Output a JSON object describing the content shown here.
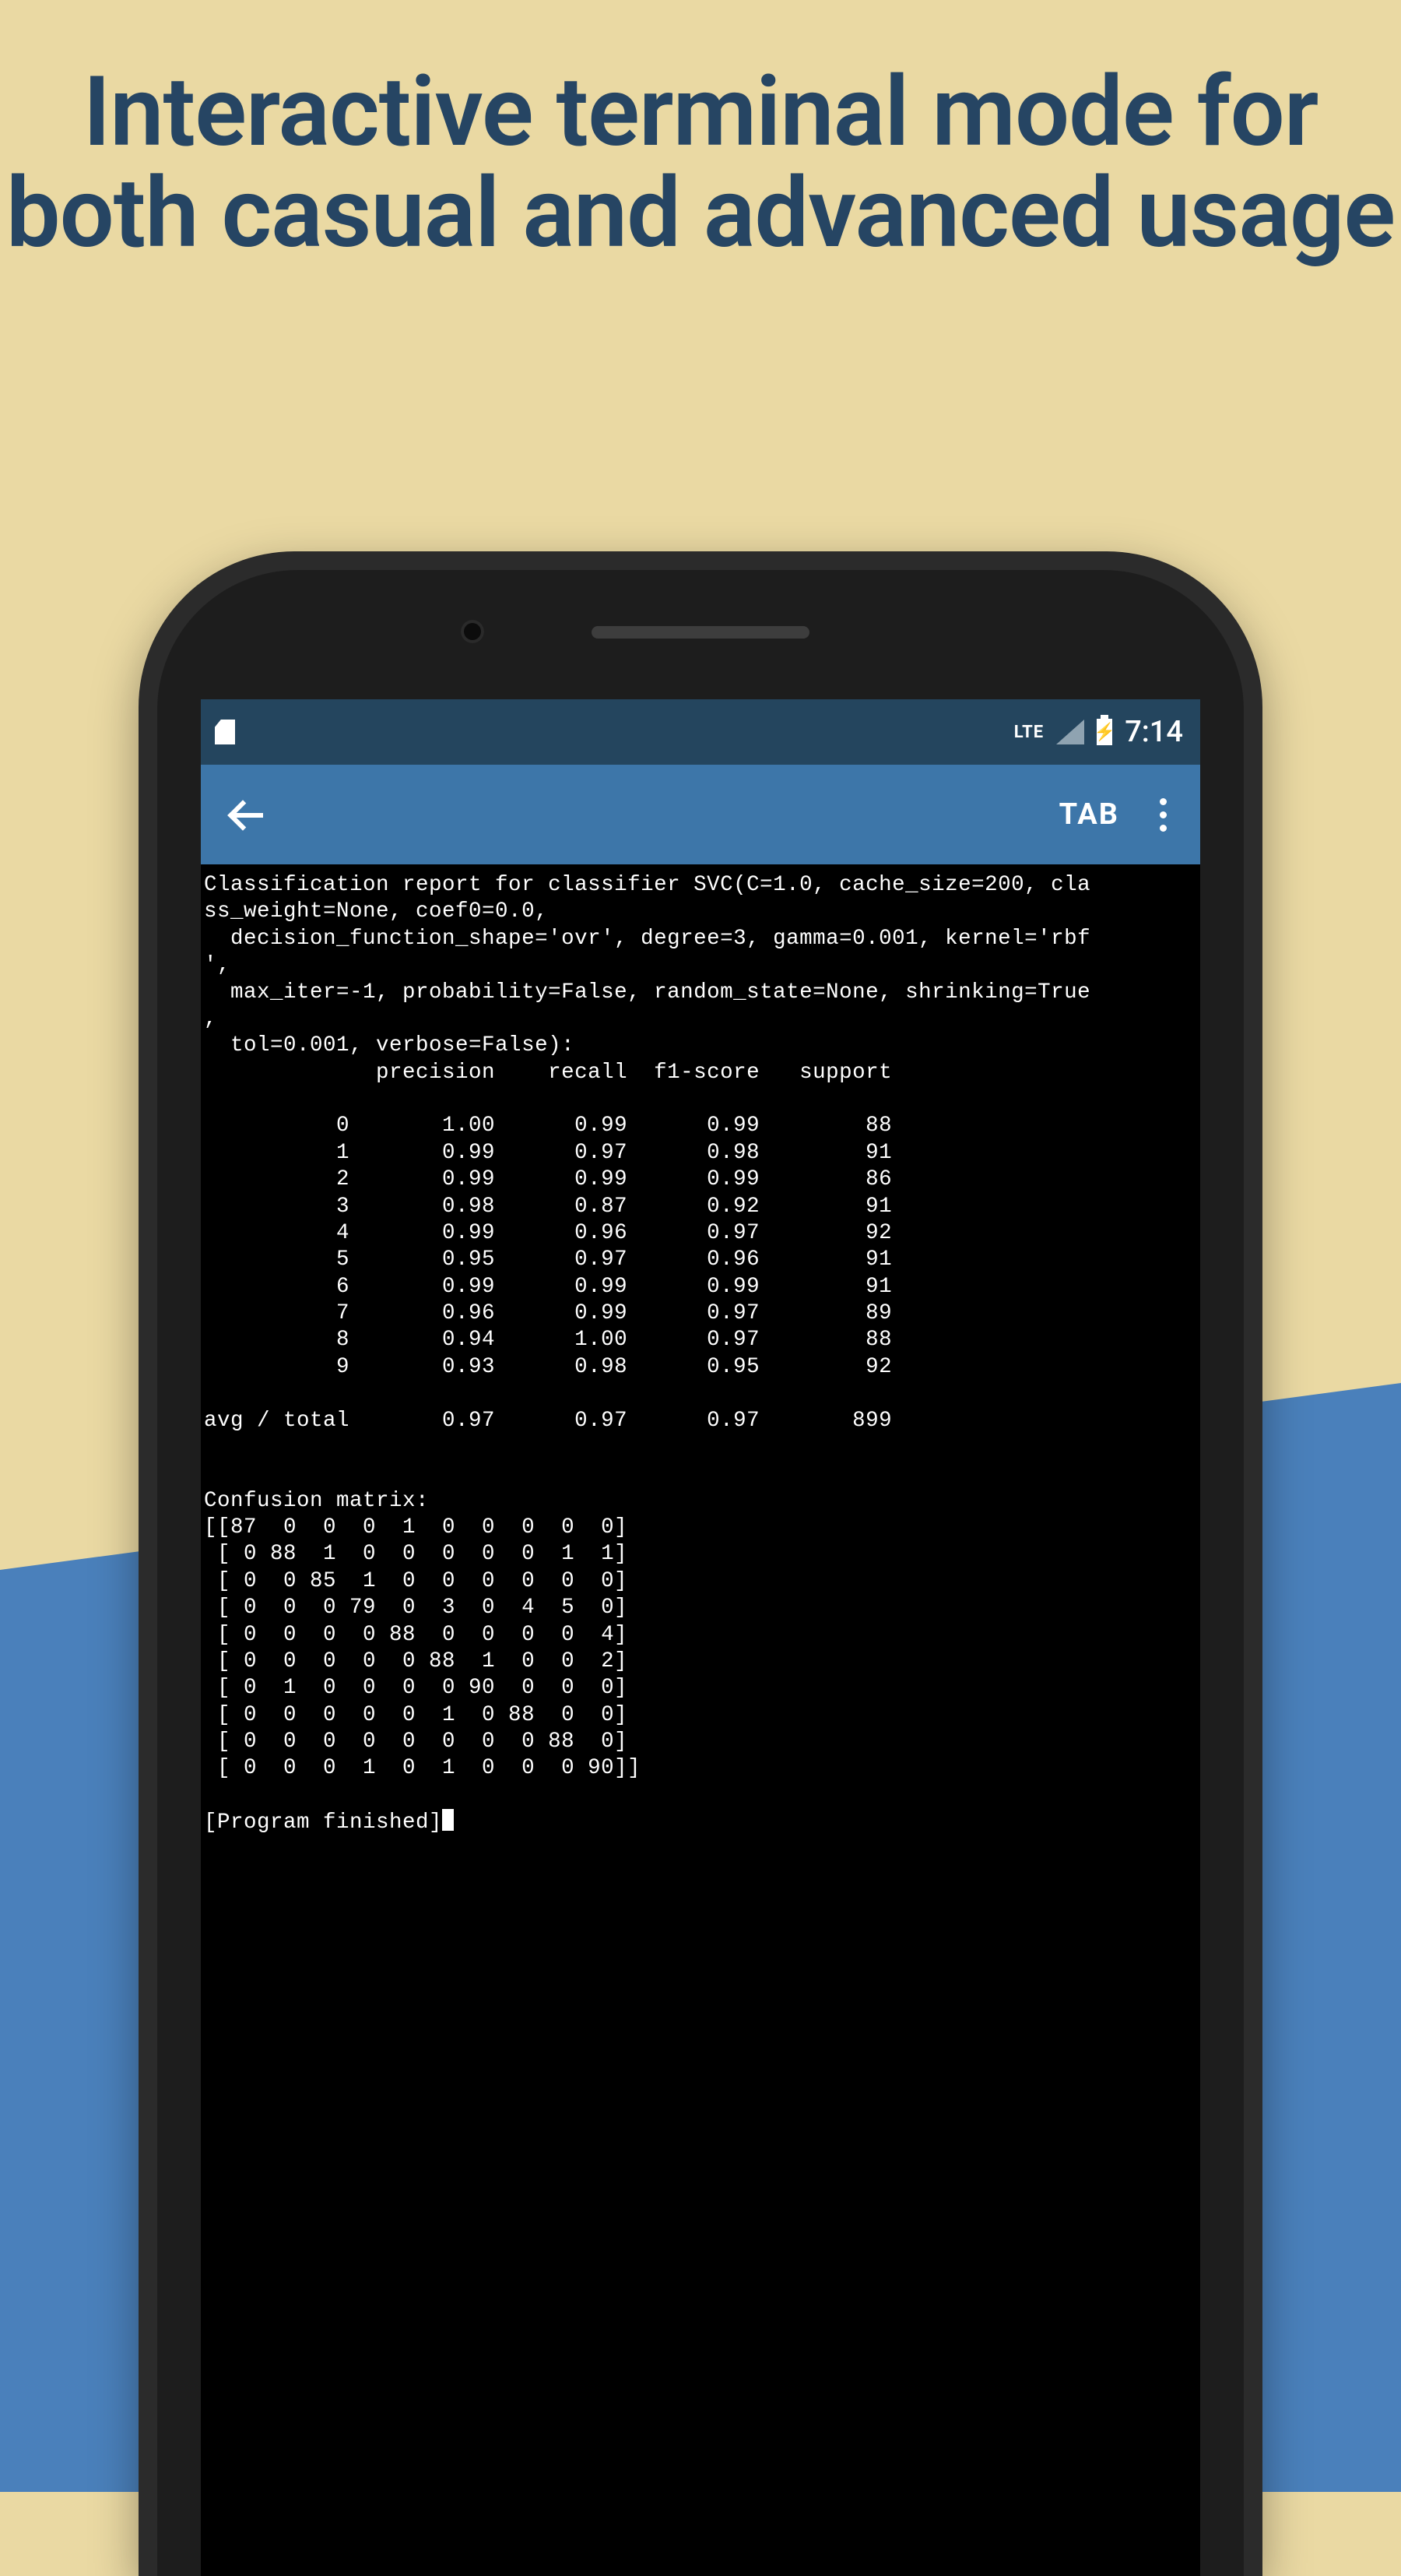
{
  "promo": {
    "headline": "Interactive terminal mode for both casual and advanced usage"
  },
  "status_bar": {
    "network_label": "LTE",
    "time": "7:14"
  },
  "app_bar": {
    "tab_label": "TAB"
  },
  "terminal": {
    "header_lines": [
      "Classification report for classifier SVC(C=1.0, cache_size=200, cla",
      "ss_weight=None, coef0=0.0,",
      "  decision_function_shape='ovr', degree=3, gamma=0.001, kernel='rbf",
      "',",
      "  max_iter=-1, probability=False, random_state=None, shrinking=True",
      ",",
      "  tol=0.001, verbose=False):"
    ],
    "report_columns": "             precision    recall  f1-score   support",
    "report_rows": [
      {
        "label": "0",
        "precision": "1.00",
        "recall": "0.99",
        "f1": "0.99",
        "support": "88"
      },
      {
        "label": "1",
        "precision": "0.99",
        "recall": "0.97",
        "f1": "0.98",
        "support": "91"
      },
      {
        "label": "2",
        "precision": "0.99",
        "recall": "0.99",
        "f1": "0.99",
        "support": "86"
      },
      {
        "label": "3",
        "precision": "0.98",
        "recall": "0.87",
        "f1": "0.92",
        "support": "91"
      },
      {
        "label": "4",
        "precision": "0.99",
        "recall": "0.96",
        "f1": "0.97",
        "support": "92"
      },
      {
        "label": "5",
        "precision": "0.95",
        "recall": "0.97",
        "f1": "0.96",
        "support": "91"
      },
      {
        "label": "6",
        "precision": "0.99",
        "recall": "0.99",
        "f1": "0.99",
        "support": "91"
      },
      {
        "label": "7",
        "precision": "0.96",
        "recall": "0.99",
        "f1": "0.97",
        "support": "89"
      },
      {
        "label": "8",
        "precision": "0.94",
        "recall": "1.00",
        "f1": "0.97",
        "support": "88"
      },
      {
        "label": "9",
        "precision": "0.93",
        "recall": "0.98",
        "f1": "0.95",
        "support": "92"
      }
    ],
    "avg_row": {
      "label": "avg / total",
      "precision": "0.97",
      "recall": "0.97",
      "f1": "0.97",
      "support": "899"
    },
    "confusion_title": "Confusion matrix:",
    "confusion_matrix": [
      [
        87,
        0,
        0,
        0,
        1,
        0,
        0,
        0,
        0,
        0
      ],
      [
        0,
        88,
        1,
        0,
        0,
        0,
        0,
        0,
        1,
        1
      ],
      [
        0,
        0,
        85,
        1,
        0,
        0,
        0,
        0,
        0,
        0
      ],
      [
        0,
        0,
        0,
        79,
        0,
        3,
        0,
        4,
        5,
        0
      ],
      [
        0,
        0,
        0,
        0,
        88,
        0,
        0,
        0,
        0,
        4
      ],
      [
        0,
        0,
        0,
        0,
        0,
        88,
        1,
        0,
        0,
        2
      ],
      [
        0,
        1,
        0,
        0,
        0,
        0,
        90,
        0,
        0,
        0
      ],
      [
        0,
        0,
        0,
        0,
        0,
        1,
        0,
        88,
        0,
        0
      ],
      [
        0,
        0,
        0,
        0,
        0,
        0,
        0,
        0,
        88,
        0
      ],
      [
        0,
        0,
        0,
        1,
        0,
        1,
        0,
        0,
        0,
        90
      ]
    ],
    "finished_label": "[Program finished]"
  }
}
